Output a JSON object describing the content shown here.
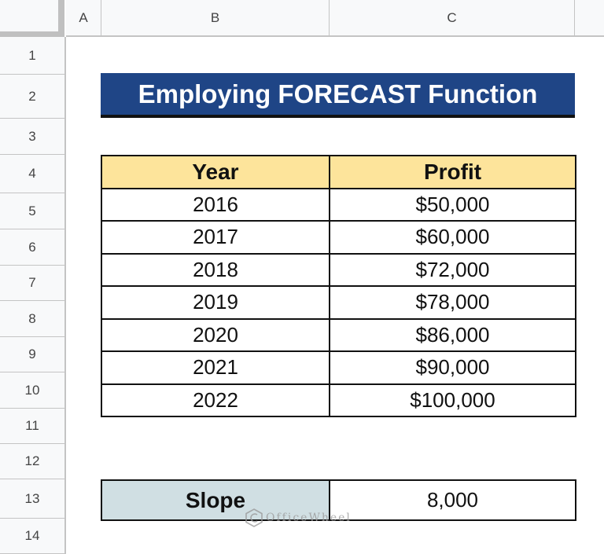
{
  "columns": [
    "A",
    "B",
    "C"
  ],
  "rows": [
    "1",
    "2",
    "3",
    "4",
    "5",
    "6",
    "7",
    "8",
    "9",
    "10",
    "11",
    "12",
    "13",
    "14"
  ],
  "title": "Employing FORECAST Function",
  "table": {
    "headers": [
      "Year",
      "Profit"
    ],
    "rows": [
      [
        "2016",
        "$50,000"
      ],
      [
        "2017",
        "$60,000"
      ],
      [
        "2018",
        "$72,000"
      ],
      [
        "2019",
        "$78,000"
      ],
      [
        "2020",
        "$86,000"
      ],
      [
        "2021",
        "$90,000"
      ],
      [
        "2022",
        "$100,000"
      ]
    ]
  },
  "slope": {
    "label": "Slope",
    "value": "8,000"
  },
  "watermark": "OfficeWheel",
  "colors": {
    "title_bg": "#1f4586",
    "header_bg": "#fde49b",
    "slope_bg": "#d0dfe3"
  }
}
